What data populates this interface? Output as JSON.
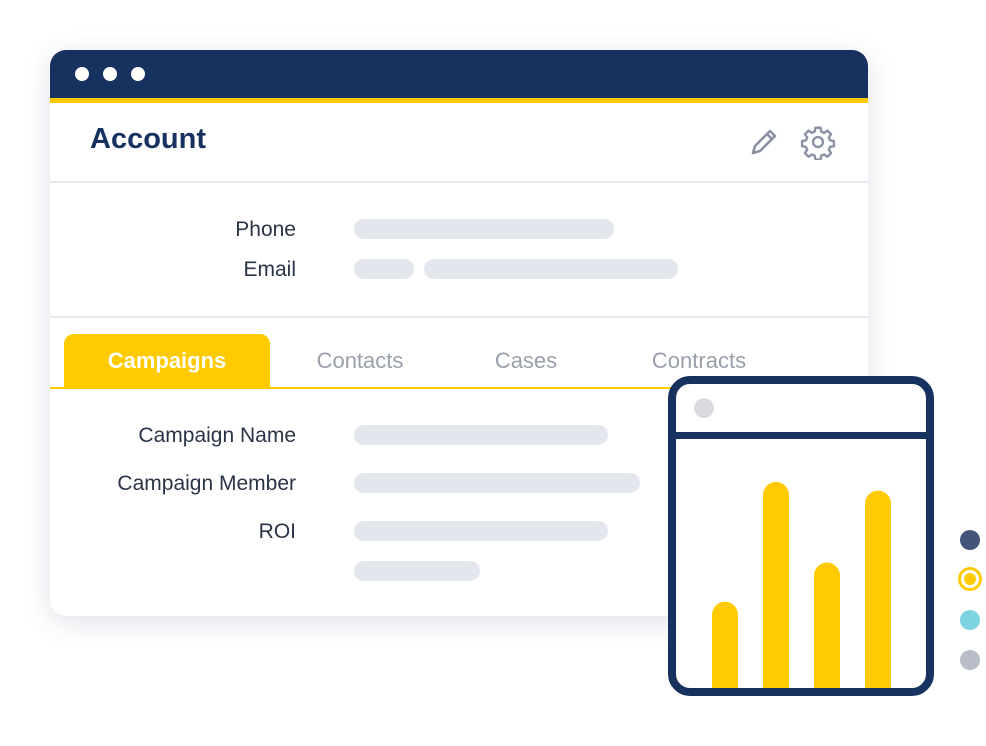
{
  "window": {
    "controls": [
      "close",
      "minimize",
      "maximize"
    ]
  },
  "header": {
    "title": "Account",
    "edit_icon": "pencil-icon",
    "settings_icon": "gear-icon"
  },
  "fields": [
    {
      "label": "Phone"
    },
    {
      "label": "Email"
    }
  ],
  "tabs": [
    {
      "label": "Campaigns",
      "active": true
    },
    {
      "label": "Contacts",
      "active": false
    },
    {
      "label": "Cases",
      "active": false
    },
    {
      "label": "Contracts",
      "active": false
    }
  ],
  "campaign_fields": [
    {
      "label": "Campaign Name"
    },
    {
      "label": "Campaign Member"
    },
    {
      "label": "ROI"
    }
  ],
  "colors": {
    "navy": "#17325e",
    "accent": "#ffcb00",
    "placeholder": "#e4e6ee",
    "teal": "#7dd3df",
    "gray": "#b9bdc8"
  },
  "chart_data": {
    "type": "bar",
    "values": [
      0.4,
      0.95,
      0.58,
      0.91
    ],
    "color": "#ffcb00"
  },
  "pager": {
    "count": 4,
    "selected_index": 1,
    "colors": [
      "#43557a",
      "#ffcb00",
      "#7dd3df",
      "#b9bdc8"
    ]
  }
}
